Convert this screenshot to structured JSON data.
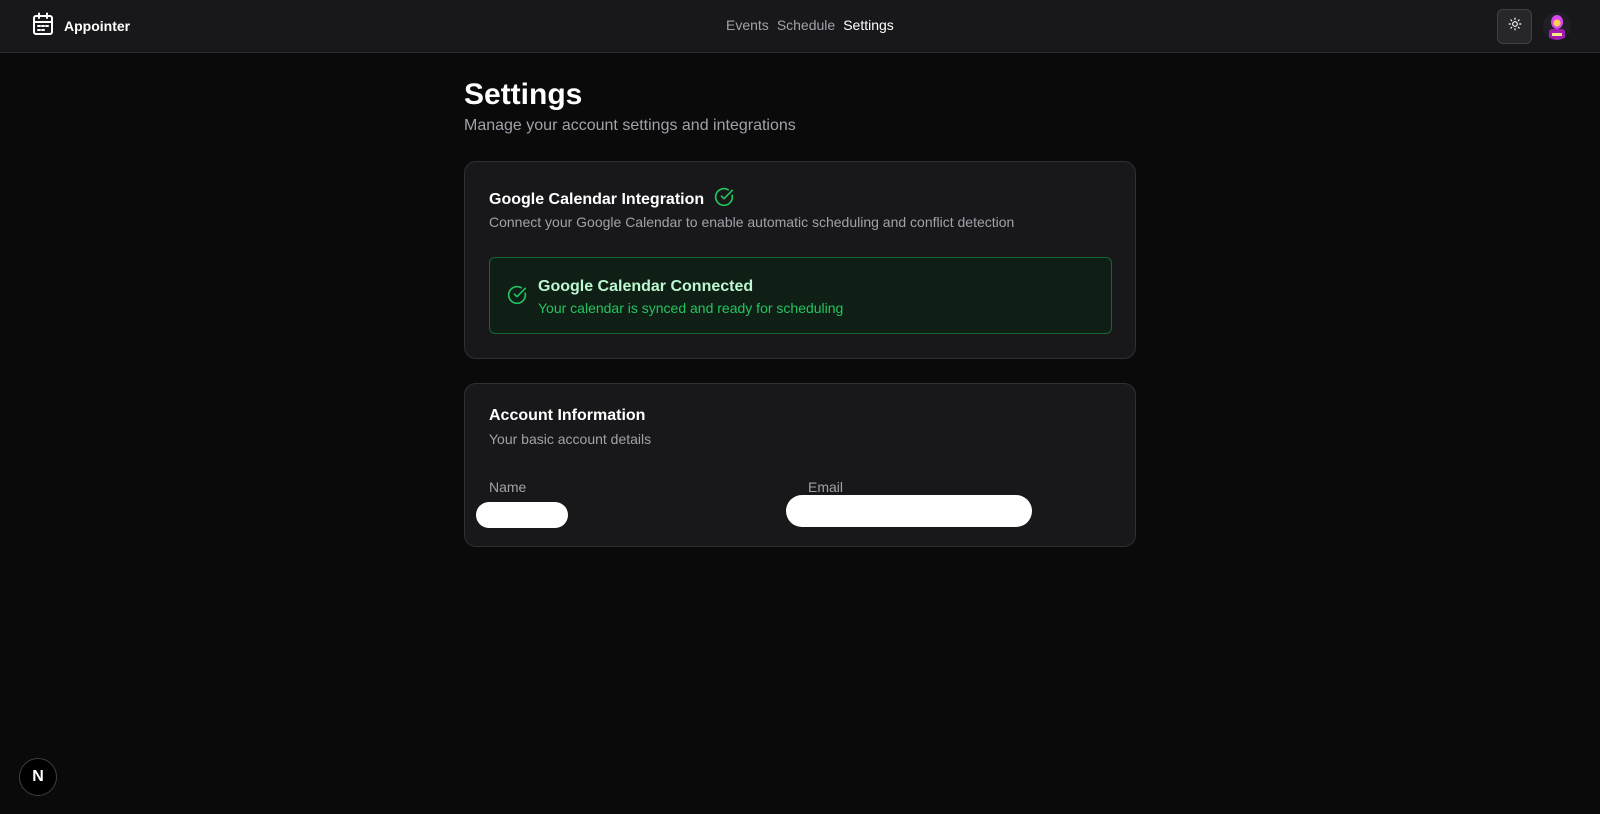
{
  "app": {
    "name": "Appointer",
    "logo_icon": "calendar-icon"
  },
  "nav": {
    "items": [
      {
        "label": "Events",
        "active": false
      },
      {
        "label": "Schedule",
        "active": false
      },
      {
        "label": "Settings",
        "active": true
      }
    ]
  },
  "header_actions": {
    "theme_icon": "sun-icon",
    "avatar_icon": "user-avatar"
  },
  "page": {
    "title": "Settings",
    "subtitle": "Manage your account settings and integrations"
  },
  "integration_card": {
    "title": "Google Calendar Integration",
    "title_icon": "check-circle-icon",
    "description": "Connect your Google Calendar to enable automatic scheduling and conflict detection",
    "status": {
      "icon": "check-circle-icon",
      "title": "Google Calendar Connected",
      "description": "Your calendar is synced and ready for scheduling"
    }
  },
  "account_card": {
    "title": "Account Information",
    "description": "Your basic account details",
    "fields": [
      {
        "label": "Name"
      },
      {
        "label": "Email"
      }
    ]
  },
  "dev_badge": {
    "label": "N"
  },
  "colors": {
    "background": "#0a0a0b",
    "card": "#18181b",
    "accent_green": "#22c55e",
    "muted_text": "#a1a1aa"
  }
}
